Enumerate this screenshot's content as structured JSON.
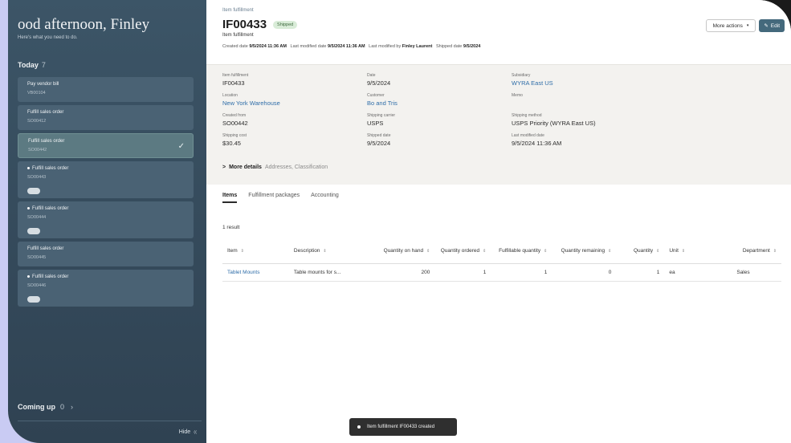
{
  "sidebar": {
    "greeting": "ood afternoon, Finley",
    "subtext": "Here's what you need to do.",
    "today_label": "Today",
    "today_count": "7",
    "tasks": [
      {
        "title": "Pay vendor bill",
        "sub": "VB00104"
      },
      {
        "title": "Fulfill sales order",
        "sub": "SO00412"
      },
      {
        "title": "Fulfill sales order",
        "sub": "SO00442"
      },
      {
        "title": "Fulfill sales order",
        "sub": "SO00443"
      },
      {
        "title": "Fulfill sales order",
        "sub": "SO00444"
      },
      {
        "title": "Fulfill sales order",
        "sub": "SO00445"
      },
      {
        "title": "Fulfill sales order",
        "sub": "SO00446"
      }
    ],
    "coming_label": "Coming up",
    "coming_count": "0",
    "coming_chevron": "›",
    "hide_label": "Hide",
    "hide_icon": "⟨⟨"
  },
  "header": {
    "breadcrumb": "Item fulfillment",
    "title": "IF00433",
    "status": "Shipped",
    "subtitle": "Item fulfillment",
    "meta": {
      "created_label": "Created date",
      "created": "9/5/2024 11:36 AM",
      "modified_label": "Last modified date",
      "modified": "9/5/2024 11:36 AM",
      "modby_label": "Last modified by",
      "modby": "Finley Laurent",
      "shipped_label": "Shipped date",
      "shipped": "9/5/2024"
    },
    "more_actions": "More actions",
    "more_caret": "▾",
    "edit": "Edit",
    "edit_icon": "✎"
  },
  "fields": {
    "item_fulfillment": {
      "label": "Item fulfillment",
      "value": "IF00433"
    },
    "date": {
      "label": "Date",
      "value": "9/5/2024"
    },
    "subsidiary": {
      "label": "Subsidiary",
      "value": "WYRA East US"
    },
    "location": {
      "label": "Location",
      "value": "New York Warehouse"
    },
    "customer": {
      "label": "Customer",
      "value": "Bo and Tris"
    },
    "memo": {
      "label": "Memo",
      "value": ""
    },
    "created_from": {
      "label": "Created from",
      "value": "SO00442"
    },
    "shipping_carrier": {
      "label": "Shipping carrier",
      "value": "USPS"
    },
    "shipping_method": {
      "label": "Shipping method",
      "value": "USPS Priority (WYRA East US)"
    },
    "shipping_cost": {
      "label": "Shipping cost",
      "value": "$30.45"
    },
    "shipped_date": {
      "label": "Shipped date",
      "value": "9/5/2024"
    },
    "last_modified": {
      "label": "Last modified date",
      "value": "9/5/2024 11:36 AM"
    }
  },
  "more_details": {
    "label": "More details",
    "hint": "Addresses, Classification",
    "chevron": ">"
  },
  "tabs": [
    "Items",
    "Fulfillment packages",
    "Accounting"
  ],
  "results": "1 result",
  "table": {
    "sort_icon": "⇕",
    "headers": [
      "Item",
      "Description",
      "Quantity on hand",
      "Quantity ordered",
      "Fulfillable quantity",
      "Quantity remaining",
      "Quantity",
      "Unit",
      "Department"
    ],
    "row": [
      "Tablet Mounts",
      "Table mounts for s...",
      "200",
      "1",
      "1",
      "0",
      "1",
      "ea",
      "Sales"
    ]
  },
  "toast": "Item fulfillment IF00433 created"
}
